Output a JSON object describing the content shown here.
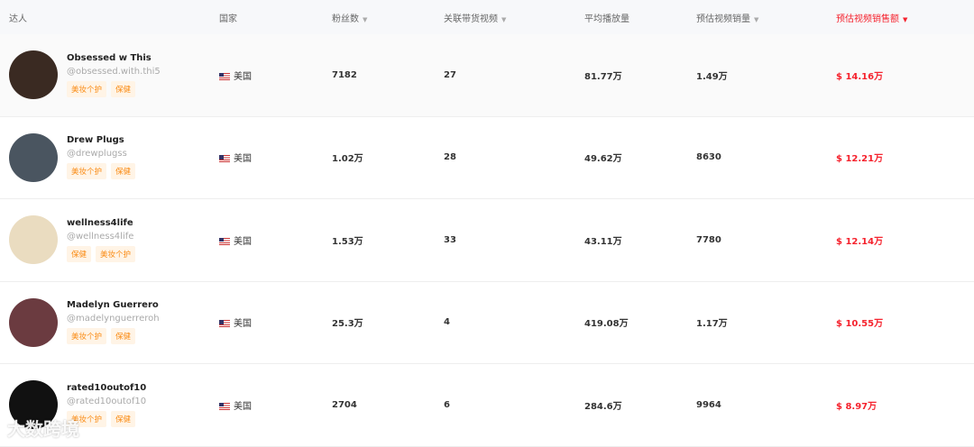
{
  "headers": {
    "influencer": "达人",
    "country": "国家",
    "followers": "粉丝数",
    "videos": "关联带货视频",
    "avg_views": "平均播放量",
    "est_sales": "预估视频销量",
    "est_revenue": "预估视频销售额",
    "sort_icon": "▼"
  },
  "rows": [
    {
      "name": "Obsessed w This",
      "handle": "@obsessed.with.thi5",
      "tags": [
        "美妆个护",
        "保健"
      ],
      "country": "美国",
      "followers": "7182",
      "videos": "27",
      "avg_views": "81.77万",
      "est_sales": "1.49万",
      "est_revenue": "$ 14.16万",
      "avatar_color": "#3a2a22"
    },
    {
      "name": "Drew Plugs",
      "handle": "@drewplugss",
      "tags": [
        "美妆个护",
        "保健"
      ],
      "country": "美国",
      "followers": "1.02万",
      "videos": "28",
      "avg_views": "49.62万",
      "est_sales": "8630",
      "est_revenue": "$ 12.21万",
      "avatar_color": "#4a5560"
    },
    {
      "name": "wellness4life",
      "handle": "@wellness4life",
      "tags": [
        "保健",
        "美妆个护"
      ],
      "country": "美国",
      "followers": "1.53万",
      "videos": "33",
      "avg_views": "43.11万",
      "est_sales": "7780",
      "est_revenue": "$ 12.14万",
      "avatar_color": "#eadcc0"
    },
    {
      "name": "Madelyn Guerrero",
      "handle": "@madelynguerreroh",
      "tags": [
        "美妆个护",
        "保健"
      ],
      "country": "美国",
      "followers": "25.3万",
      "videos": "4",
      "avg_views": "419.08万",
      "est_sales": "1.17万",
      "est_revenue": "$ 10.55万",
      "avatar_color": "#6b3b40"
    },
    {
      "name": "rated10outof10",
      "handle": "@rated10outof10",
      "tags": [
        "美妆个护",
        "保健"
      ],
      "country": "美国",
      "followers": "2704",
      "videos": "6",
      "avg_views": "284.6万",
      "est_sales": "9964",
      "est_revenue": "$ 8.97万",
      "avatar_color": "#111"
    }
  ],
  "watermark": "大数跨境"
}
